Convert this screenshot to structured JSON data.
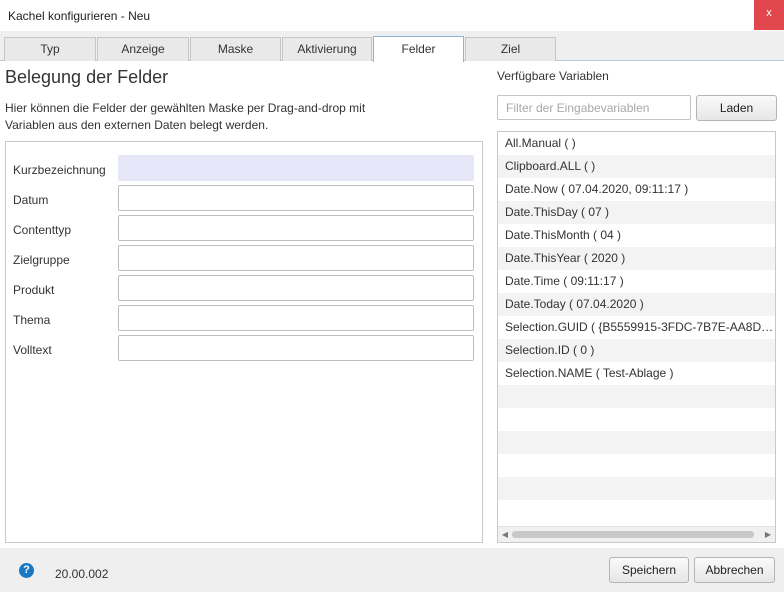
{
  "window": {
    "title": "Kachel konfigurieren - Neu",
    "close_glyph": "x"
  },
  "tabs": [
    {
      "label": "Typ",
      "active": false
    },
    {
      "label": "Anzeige",
      "active": false
    },
    {
      "label": "Maske",
      "active": false
    },
    {
      "label": "Aktivierung",
      "active": false
    },
    {
      "label": "Felder",
      "active": true
    },
    {
      "label": "Ziel",
      "active": false
    }
  ],
  "fields_panel": {
    "heading": "Belegung der Felder",
    "description_line1": "Hier können die Felder der gewählten Maske per Drag-and-drop mit",
    "description_line2": "Variablen aus den externen Daten belegt werden.",
    "fields": [
      {
        "label": "Kurzbezeichnung",
        "value": ""
      },
      {
        "label": "Datum",
        "value": ""
      },
      {
        "label": "Contenttyp",
        "value": ""
      },
      {
        "label": "Zielgruppe",
        "value": ""
      },
      {
        "label": "Produkt",
        "value": ""
      },
      {
        "label": "Thema",
        "value": ""
      },
      {
        "label": "Volltext",
        "value": ""
      }
    ]
  },
  "variables_panel": {
    "label": "Verfügbare Variablen",
    "filter_placeholder": "Filter der Eingabevariablen",
    "filter_value": "",
    "load_button": "Laden",
    "items": [
      "All.Manual (  )",
      "Clipboard.ALL (  )",
      "Date.Now ( 07.04.2020, 09:11:17 )",
      "Date.ThisDay ( 07 )",
      "Date.ThisMonth ( 04 )",
      "Date.ThisYear ( 2020 )",
      "Date.Time ( 09:11:17 )",
      "Date.Today ( 07.04.2020 )",
      "Selection.GUID ( {B5559915-3FDC-7B7E-AA8D-8B...",
      "Selection.ID ( 0 )",
      "Selection.NAME ( Test-Ablage )"
    ]
  },
  "footer": {
    "help_glyph": "?",
    "version": "20.00.002",
    "save_button": "Speichern",
    "cancel_button": "Abbrechen"
  },
  "colors": {
    "close_button": "#e0484e",
    "active_tab_border": "#8eb4d2",
    "highlighted_field": "#e6e8f9",
    "help_icon": "#1a78c2"
  }
}
